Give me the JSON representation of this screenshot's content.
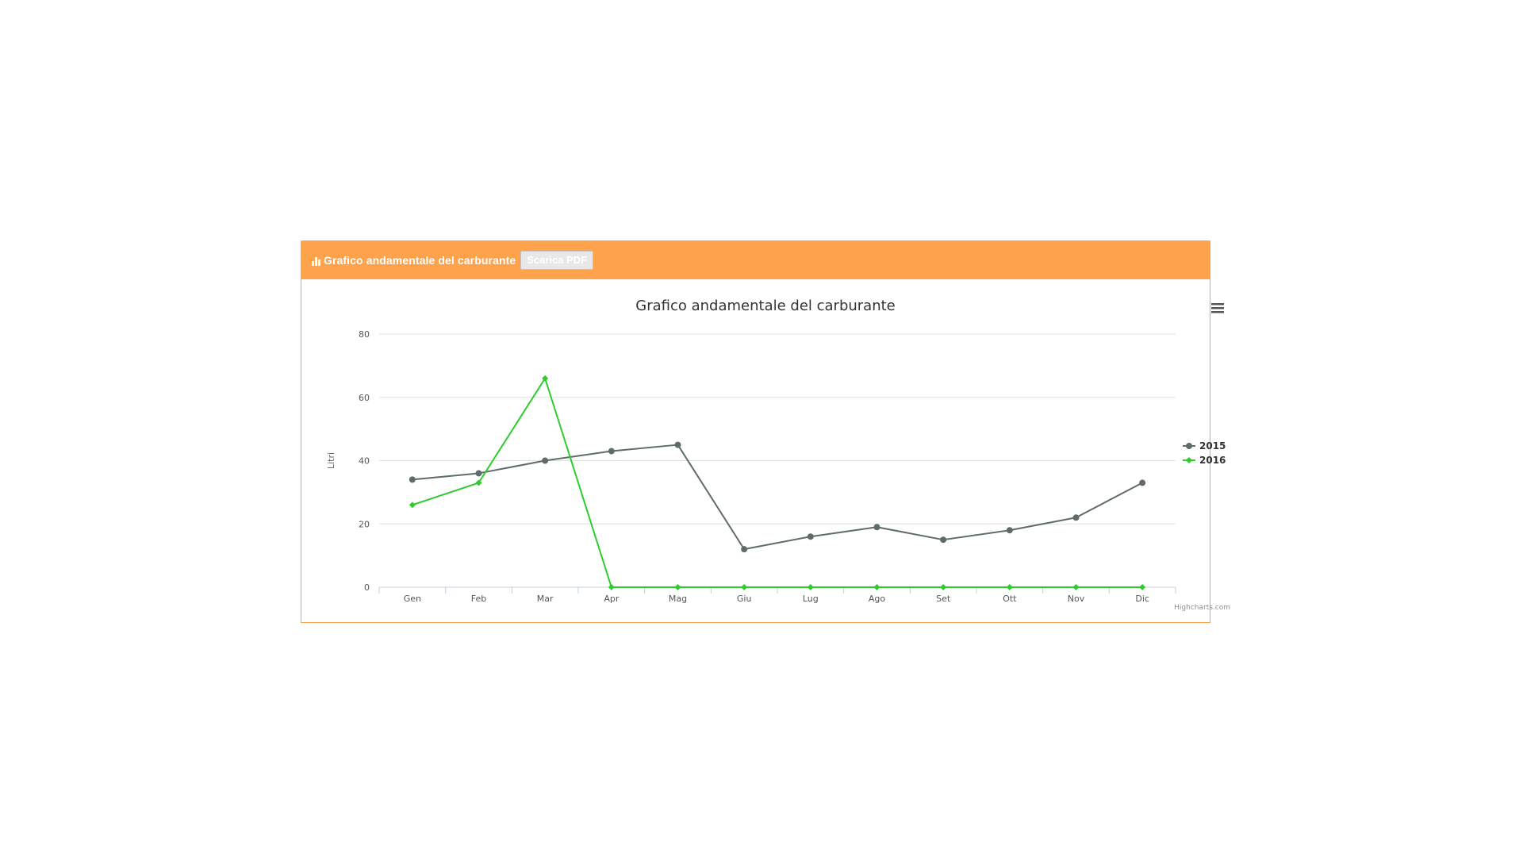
{
  "panel": {
    "title": "Grafico andamentale del carburante",
    "pdf_button": "Scarica PDF",
    "header_icon": "bar-chart-icon",
    "accent_color": "#ffa24c"
  },
  "chart_menu_icon": "hamburger-menu-icon",
  "credits": "Highcharts.com",
  "chart_data": {
    "type": "line",
    "title": "Grafico andamentale del carburante",
    "xlabel": "",
    "ylabel": "Litri",
    "ylim": [
      0,
      80
    ],
    "yticks": [
      0,
      20,
      40,
      60,
      80
    ],
    "grid": true,
    "legend_position": "right",
    "categories": [
      "Gen",
      "Feb",
      "Mar",
      "Apr",
      "Mag",
      "Giu",
      "Lug",
      "Ago",
      "Set",
      "Ott",
      "Nov",
      "Dic"
    ],
    "series": [
      {
        "name": "2015",
        "color": "#5f6b6b",
        "marker": "circle",
        "values": [
          34,
          36,
          40,
          43,
          45,
          12,
          16,
          19,
          15,
          18,
          22,
          33
        ]
      },
      {
        "name": "2016",
        "color": "#2ecc2e",
        "marker": "diamond",
        "values": [
          26,
          33,
          66,
          0,
          0,
          0,
          0,
          0,
          0,
          0,
          0,
          0
        ]
      }
    ]
  }
}
